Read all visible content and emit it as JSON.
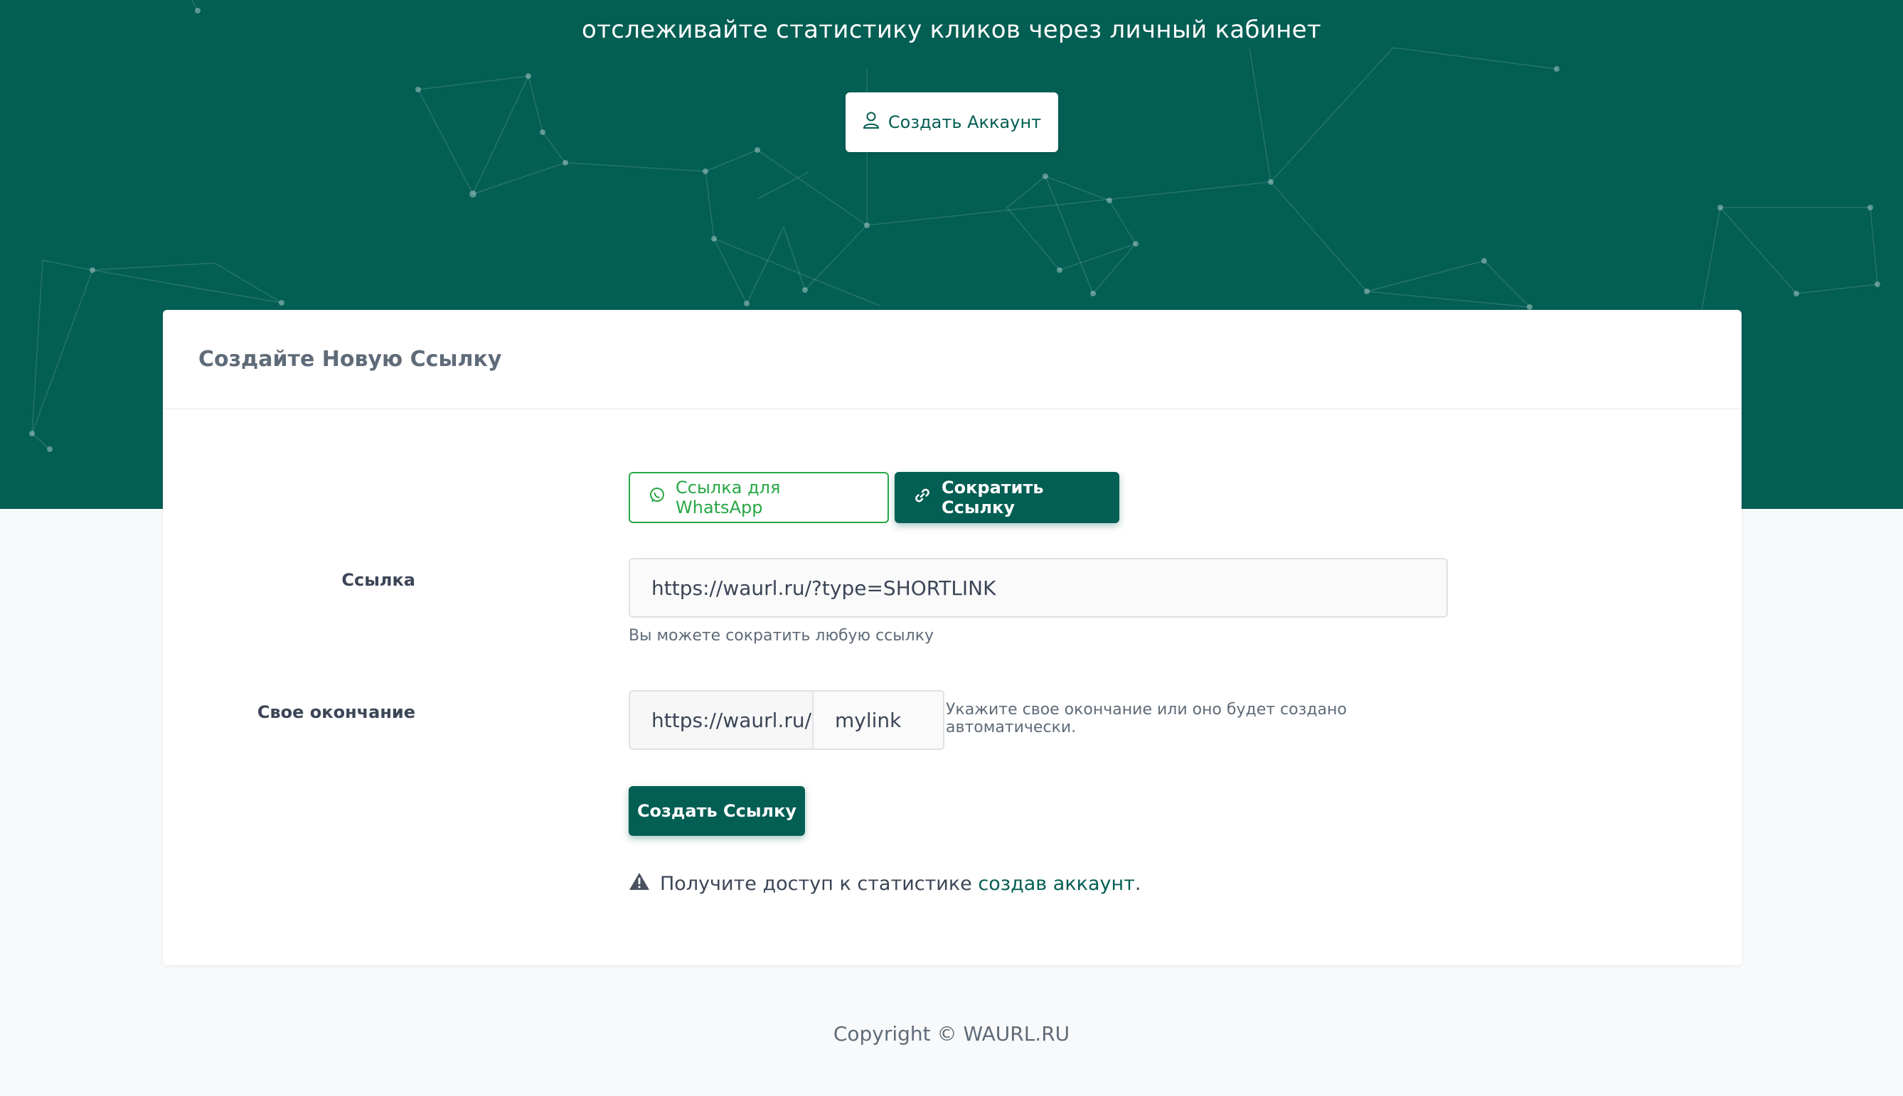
{
  "hero": {
    "subtitle": "отслеживайте статистику кликов через личный кабинет",
    "account_button": {
      "label": "Создать Аккаунт",
      "icon": "user-icon"
    }
  },
  "card": {
    "title": "Создайте Новую Ссылку",
    "tabs": [
      {
        "label": "Ссылка для WhatsApp",
        "icon": "whatsapp-icon",
        "active": false,
        "color": "#28a745"
      },
      {
        "label": "Сократить Ссылку",
        "icon": "link-icon",
        "active": true,
        "color": "#035e53"
      }
    ],
    "link_field": {
      "label": "Ссылка",
      "value": "https://waurl.ru/?type=SHORTLINK",
      "help": "Вы можете сократить любую ссылку"
    },
    "ending_field": {
      "label": "Свое окончание",
      "prefix": "https://waurl.ru/",
      "value": "mylink",
      "help": "Укажите свое окончание или оно будет создано автоматически."
    },
    "create_button": "Создать Ссылку",
    "notice": {
      "icon": "warning-icon",
      "text": "Получите доступ к статистике",
      "link": "создав аккаунт",
      "suffix": "."
    }
  },
  "footer": {
    "copyright": "Copyright © WAURL.RU"
  },
  "colors": {
    "brand": "#035e53",
    "whatsapp": "#28a745",
    "background": "#f8f9fa"
  }
}
